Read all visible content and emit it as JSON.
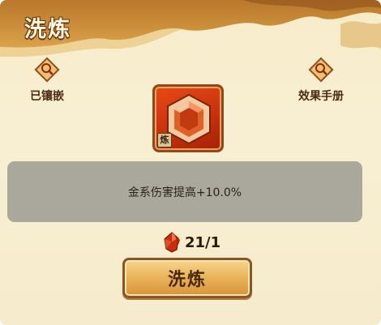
{
  "window": {
    "title": "洗炼"
  },
  "actions": {
    "embedded_label": "已镶嵌",
    "manual_label": "效果手册"
  },
  "gem": {
    "badge": "炼"
  },
  "stat": {
    "text": "金系伤害提高+10.0%"
  },
  "cost": {
    "amount": "21/1",
    "icon": "red-crystal-icon"
  },
  "refine_button": {
    "label": "洗炼"
  },
  "colors": {
    "panel": "#f7ecc9",
    "header": "#c98f3a",
    "gem": "#d8400f",
    "stat_box": "#aaa79c",
    "button": "#e9b25a"
  }
}
